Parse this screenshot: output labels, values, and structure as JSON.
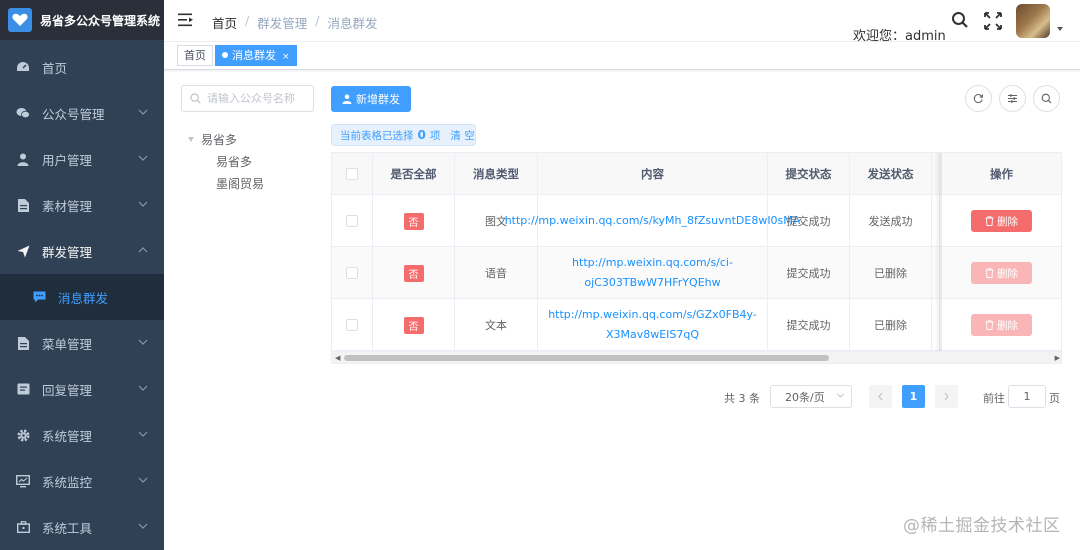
{
  "app": {
    "title": "易省多公众号管理系统"
  },
  "sidebar": {
    "items": [
      {
        "label": "首页",
        "icon": "dashboard-icon"
      },
      {
        "label": "公众号管理",
        "icon": "wechat-icon"
      },
      {
        "label": "用户管理",
        "icon": "user-icon"
      },
      {
        "label": "素材管理",
        "icon": "document-icon"
      },
      {
        "label": "群发管理",
        "icon": "send-icon"
      },
      {
        "label": "消息群发",
        "icon": "message-icon"
      },
      {
        "label": "菜单管理",
        "icon": "document-icon"
      },
      {
        "label": "回复管理",
        "icon": "reply-icon"
      },
      {
        "label": "系统管理",
        "icon": "gear-icon"
      },
      {
        "label": "系统监控",
        "icon": "monitor-icon"
      },
      {
        "label": "系统工具",
        "icon": "toolbox-icon"
      }
    ]
  },
  "header": {
    "breadcrumb": [
      "首页",
      "群发管理",
      "消息群发"
    ],
    "welcome": "欢迎您：admin"
  },
  "tags": {
    "home": "首页",
    "active": "消息群发",
    "close": "×"
  },
  "tree": {
    "search_placeholder": "请输入公众号名称",
    "root": "易省多",
    "children": [
      "易省多",
      "墨阁贸易"
    ]
  },
  "toolbar": {
    "add_label": "新增群发"
  },
  "selection": {
    "text": "当前表格已选择",
    "count": "0",
    "unit": "项",
    "clear": "清 空"
  },
  "table": {
    "headers": {
      "all": "是否全部",
      "type": "消息类型",
      "content": "内容",
      "submit_status": "提交状态",
      "send_status": "发送状态",
      "actions": "操作"
    },
    "rows": [
      {
        "all": "否",
        "type": "图文",
        "content": "http://mp.weixin.qq.com/s/kyMh_8fZsuvntDE8wI0sMA",
        "submit_status": "提交成功",
        "send_status": "发送成功",
        "delete": "删除",
        "delete_enabled": true
      },
      {
        "all": "否",
        "type": "语音",
        "content": "http://mp.weixin.qq.com/s/ci-ojC303TBwW7HFrYQEhw",
        "submit_status": "提交成功",
        "send_status": "已删除",
        "delete": "删除",
        "delete_enabled": false
      },
      {
        "all": "否",
        "type": "文本",
        "content": "http://mp.weixin.qq.com/s/GZx0FB4y-X3Mav8wEIS7qQ",
        "submit_status": "提交成功",
        "send_status": "已删除",
        "delete": "删除",
        "delete_enabled": false
      }
    ]
  },
  "pagination": {
    "total": "共 3 条",
    "page_size": "20条/页",
    "current_page": "1",
    "goto_label": "前往",
    "goto_value": "1",
    "page_unit": "页"
  },
  "watermark": "@稀土掘金技术社区",
  "colors": {
    "sidebar_bg": "#304156",
    "primary": "#409eff",
    "danger": "#f56c6c"
  }
}
